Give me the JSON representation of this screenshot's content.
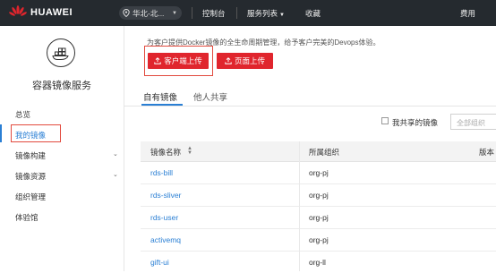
{
  "topbar": {
    "brand": "HUAWEI",
    "region": "华北-北...",
    "nav": [
      "控制台",
      "服务列表",
      "收藏"
    ],
    "right": "费用"
  },
  "sidebar": {
    "service_title": "容器镜像服务",
    "items": [
      {
        "label": "总览",
        "expandable": false
      },
      {
        "label": "我的镜像",
        "expandable": false,
        "active": true
      },
      {
        "label": "镜像构建",
        "expandable": true
      },
      {
        "label": "镜像资源",
        "expandable": true
      },
      {
        "label": "组织管理",
        "expandable": false
      },
      {
        "label": "体验馆",
        "expandable": false
      }
    ]
  },
  "main": {
    "description": "为客户提供Docker镜像的全生命周期管理，给予客户完美的Devops体验。",
    "buttons": {
      "client_upload": "客户端上传",
      "page_upload": "页面上传"
    },
    "tabs": [
      "自有镜像",
      "他人共享"
    ],
    "filter": {
      "shared_label": "我共享的镜像",
      "org_placeholder": "全部组织"
    },
    "table": {
      "headers": [
        "镜像名称",
        "所属组织",
        "版本"
      ],
      "rows": [
        {
          "name": "rds-bill",
          "org": "org-pj"
        },
        {
          "name": "rds-sliver",
          "org": "org-pj"
        },
        {
          "name": "rds-user",
          "org": "org-pj"
        },
        {
          "name": "activemq",
          "org": "org-pj"
        },
        {
          "name": "gift-ui",
          "org": "org-ll"
        }
      ]
    }
  },
  "colors": {
    "accent": "#e0252d",
    "link": "#2a7fd4",
    "topbar": "#252a2f"
  }
}
